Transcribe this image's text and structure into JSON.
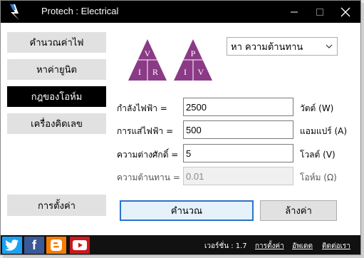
{
  "window": {
    "title": "Protech : Electrical"
  },
  "sidebar": {
    "items": [
      {
        "label": "คำนวณค่าไฟ"
      },
      {
        "label": "หาค่ายูนิต"
      },
      {
        "label": "กฎของโอห์ม"
      },
      {
        "label": "เครื่องคิดเลข"
      }
    ],
    "settings_label": "การตั้งค่า"
  },
  "triangles": {
    "vir": {
      "top": "V",
      "left": "I",
      "right": "R"
    },
    "piv": {
      "top": "P",
      "left": "I",
      "right": "V"
    },
    "color": "#8b3a86"
  },
  "mode_select": {
    "value": "หา ความต้านทาน"
  },
  "form": {
    "power": {
      "label": "กำลังไฟฟ้า =",
      "value": "2500",
      "unit": "วัตต์ (W)"
    },
    "current": {
      "label": "การแส่ไฟฟ้า =",
      "value": "500",
      "unit": "แอมแปร์ (A)"
    },
    "voltage": {
      "label": "ความต่างศักดิ์ =",
      "value": "5",
      "unit": "โวลต์ (V)"
    },
    "resistance": {
      "label": "ความต้านทาน =",
      "value": "0.01",
      "unit": "โอห์ม (Ω)"
    }
  },
  "actions": {
    "calculate": "คำนวณ",
    "clear": "ล้างค่า"
  },
  "footer": {
    "version": "เวอร์ชั่น : 1.7",
    "settings": "การตั้งค่า",
    "update": "อัพเดต",
    "contact": "ติดต่อเรา",
    "social": [
      "twitter-icon",
      "facebook-icon",
      "blogger-icon",
      "youtube-icon"
    ]
  }
}
